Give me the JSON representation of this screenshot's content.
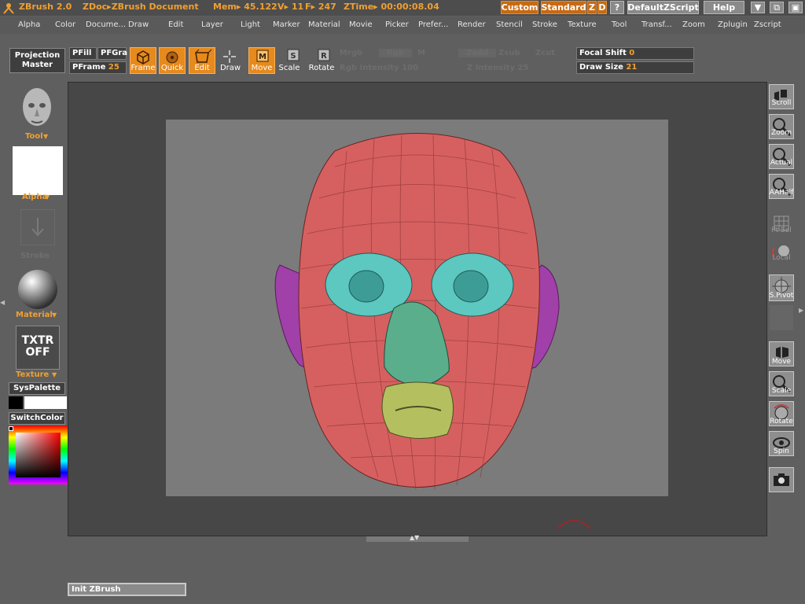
{
  "titlebar": {
    "app": "ZBrush 2.0",
    "doc": "ZDoc▸ZBrush Document",
    "mem": "Mem▸ 45.122",
    "verts": "V▸ 11",
    "faces": "F▸ 247",
    "ztime": "ZTime▸ 00:00:08.04",
    "custom": "Custom",
    "standard": "Standard",
    "z": "Z",
    "d": "D",
    "q": "?",
    "script": "DefaultZScript",
    "help": "Help",
    "win_min": "▼",
    "win_restore": "⧉",
    "win_close": "▣"
  },
  "menus": [
    "Alpha",
    "Color",
    "Docume...",
    "Draw",
    "Edit",
    "Layer",
    "Light",
    "Marker",
    "Material",
    "Movie",
    "Picker",
    "Prefer...",
    "Render",
    "Stencil",
    "Stroke",
    "Texture",
    "Tool",
    "Transf...",
    "Zoom",
    "Zplugin",
    "Zscript"
  ],
  "shelf": {
    "projection_master": "Projection Master",
    "pfill": "PFill",
    "pfgra": "PFGra",
    "pframe_label": "PFrame",
    "pframe_value": "25",
    "frame": "Frame",
    "quick": "Quick",
    "edit": "Edit",
    "draw": "Draw",
    "move": "Move",
    "scale": "Scale",
    "rotate": "Rotate",
    "mrgb": "Mrgb",
    "rgb": "Rgb",
    "m": "M",
    "zadd": "Zadd",
    "zsub": "Zsub",
    "zcut": "Zcut",
    "rgb_intensity": "Rgb Intensity 100",
    "z_intensity": "Z Intensity 25",
    "focal_shift_label": "Focal Shift",
    "focal_shift_value": "0",
    "draw_size_label": "Draw Size",
    "draw_size_value": "21"
  },
  "left": {
    "tool": "Tool",
    "alpha": "Alpha",
    "stroke": "Stroke",
    "material": "Material",
    "txtr": "TXTR",
    "off": "OFF",
    "texture": "Texture",
    "syspalette": "SysPalette",
    "switchcolor": "SwitchColor"
  },
  "right": {
    "scroll": "Scroll",
    "zoom": "Zoom",
    "actual": "Actual",
    "aahalf": "AAHalf",
    "ptsel": "Pt Sel",
    "local": "Local",
    "spivot": "S.Pivot",
    "move": "Move",
    "scale": "Scale",
    "rotate": "Rotate",
    "spin": "Spin"
  },
  "status": "Init ZBrush",
  "colors": {
    "accent": "#e68a1e",
    "skin": "#d66060",
    "eyes": "#5cc8c0",
    "ears": "#a040a8",
    "mouth": "#b4c060"
  }
}
